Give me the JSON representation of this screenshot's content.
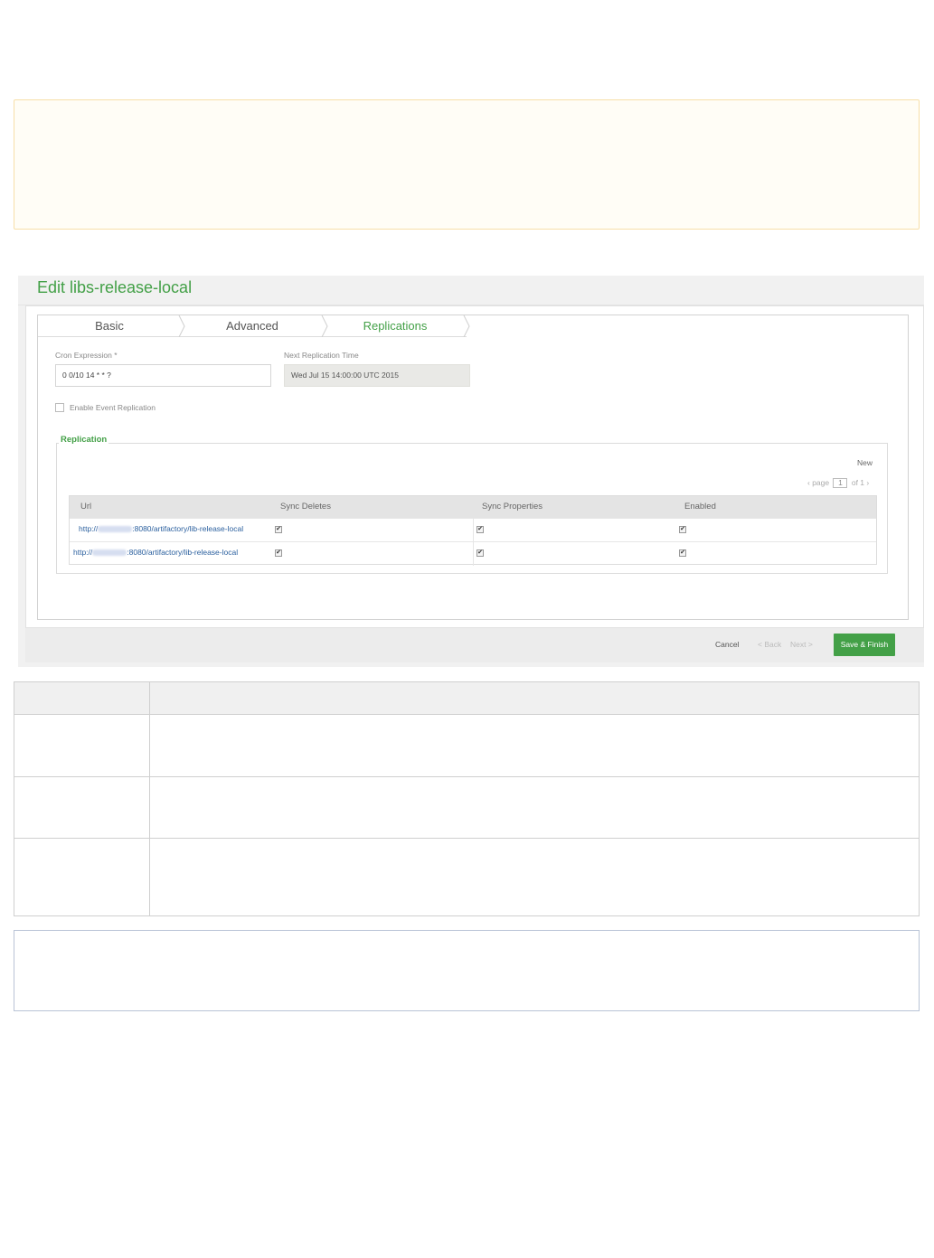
{
  "screenshot": {
    "title": "Edit libs-release-local",
    "tabs": [
      {
        "label": "Basic"
      },
      {
        "label": "Advanced"
      },
      {
        "label": "Replications"
      }
    ],
    "active_tab": "Replications",
    "cron": {
      "label": "Cron Expression *",
      "value": "0 0/10 14 * * ?"
    },
    "next_time": {
      "label": "Next Replication Time",
      "value": "Wed Jul 15 14:00:00 UTC 2015"
    },
    "event_replication": {
      "label": "Enable Event Replication",
      "checked": false
    },
    "replication": {
      "legend": "Replication",
      "new_label": "New",
      "pager": {
        "prefix": "‹ page",
        "page": "1",
        "suffix": "of 1 ›"
      },
      "columns": [
        "Url",
        "Sync Deletes",
        "Sync Properties",
        "Enabled"
      ],
      "rows": [
        {
          "url_prefix": "http://",
          "url_suffix": ":8080/artifactory/lib-release-local",
          "sync_deletes": true,
          "sync_properties": true,
          "enabled": true
        },
        {
          "url_prefix": "http://",
          "url_suffix": ":8080/artifactory/lib-release-local",
          "sync_deletes": true,
          "sync_properties": true,
          "enabled": true
        }
      ]
    },
    "footer": {
      "cancel": "Cancel",
      "back": "< Back",
      "next": "Next >",
      "save": "Save & Finish"
    }
  },
  "colors": {
    "accent_green": "#43a047",
    "link_blue": "#2a5f9e",
    "warning_border": "#f7dfa8",
    "note_border": "#b9c3d6"
  },
  "icons": {
    "tab_separator": "chevron-right-icon",
    "checkbox": "checkbox-checked-icon"
  }
}
